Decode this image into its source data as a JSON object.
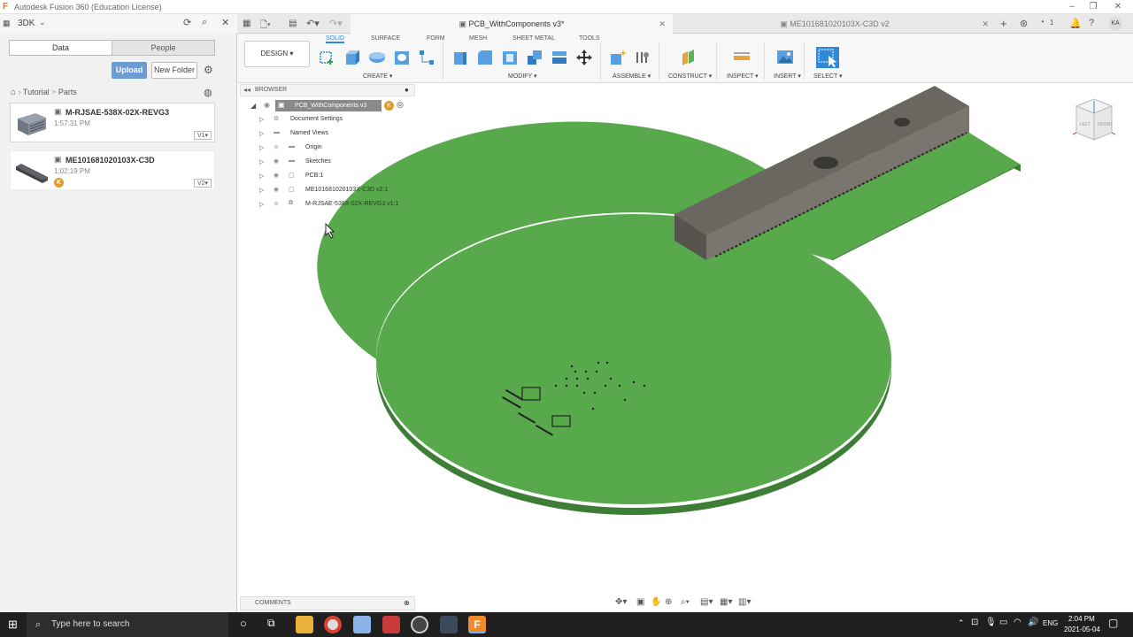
{
  "window": {
    "title": "Autodesk Fusion 360 (Education License)"
  },
  "left_panel": {
    "project": "3DK",
    "tabs": [
      "Data",
      "People"
    ],
    "upload_label": "Upload",
    "new_folder_label": "New Folder",
    "breadcrumb": {
      "root": "Tutorial",
      "sep": ">",
      "current": "Parts"
    },
    "files": [
      {
        "name": "M-RJSAE-538X-02X-REVG3",
        "time": "1:57:31 PM",
        "version": "V1▾"
      },
      {
        "name": "ME101681020103X-C3D",
        "time": "1:02:19 PM",
        "version": "V2▾",
        "badge": "K"
      }
    ]
  },
  "doc_tabs": [
    {
      "label": "PCB_WithComponents v3*",
      "active": true
    },
    {
      "label": "ME101681020103X-C3D v2",
      "active": false
    }
  ],
  "toolbar": {
    "workspace": "DESIGN ▾",
    "tabs": [
      "SOLID",
      "SURFACE",
      "FORM",
      "MESH",
      "SHEET METAL",
      "TOOLS"
    ],
    "groups": [
      "CREATE ▾",
      "MODIFY ▾",
      "ASSEMBLE ▾",
      "CONSTRUCT ▾",
      "INSPECT ▾",
      "INSERT ▾",
      "SELECT ▾"
    ]
  },
  "browser": {
    "title": "BROWSER",
    "root": "PCB_WithComponents v3",
    "items": [
      "Document Settings",
      "Named Views",
      "Origin",
      "Sketches",
      "PCB:1",
      "ME101681020103X-C3D v2:1",
      "M-RJSAE-538X-02X-REVG3 v1:1"
    ]
  },
  "comments_label": "COMMENTS",
  "user": {
    "initials": "KA",
    "notif_count": "1"
  },
  "taskbar": {
    "search_placeholder": "Type here to search",
    "lang": "ENG",
    "time": "2:04 PM",
    "date": "2021-05-04"
  },
  "viewcube": {
    "left": "LEFT",
    "front": "FRONT"
  },
  "colors": {
    "pcb_green": "#55a84c",
    "accent_blue": "#2f8bd8",
    "upload_blue": "#6c9cd2"
  }
}
